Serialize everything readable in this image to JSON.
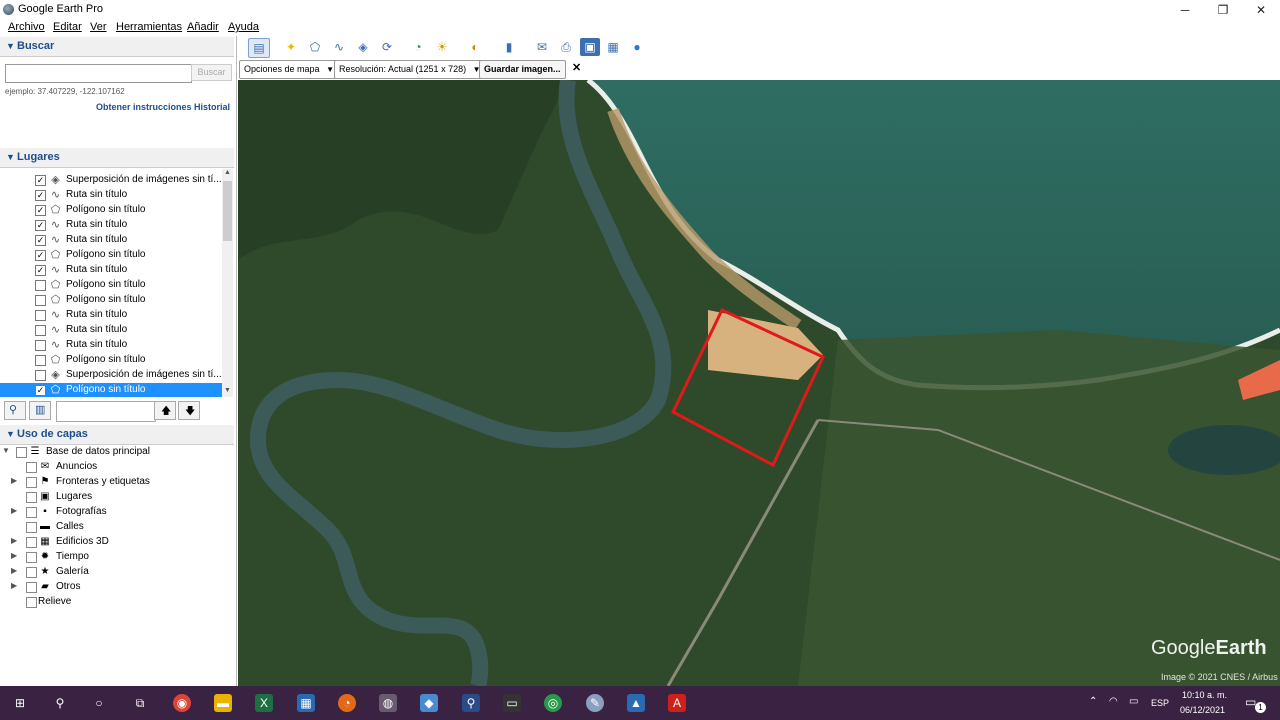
{
  "window": {
    "title": "Google Earth Pro",
    "minimize": "─",
    "maximize": "❐",
    "close": "✕"
  },
  "menu": [
    "Archivo",
    "Editar",
    "Ver",
    "Herramientas",
    "Añadir",
    "Ayuda"
  ],
  "search": {
    "header": "Buscar",
    "input_value": "",
    "button": "Buscar",
    "example": "ejemplo: 37.407229, -122.107162",
    "directions_link": "Obtener instrucciones",
    "history_link": "Historial"
  },
  "places": {
    "header": "Lugares",
    "items": [
      {
        "label": "Superposición de imágenes sin tí...",
        "checked": true,
        "icon": "image-overlay-icon",
        "selected": false
      },
      {
        "label": "Ruta sin título",
        "checked": true,
        "icon": "path-icon",
        "selected": false
      },
      {
        "label": "Polígono sin título",
        "checked": true,
        "icon": "polygon-icon",
        "selected": false
      },
      {
        "label": "Ruta sin título",
        "checked": true,
        "icon": "path-icon",
        "selected": false
      },
      {
        "label": "Ruta sin título",
        "checked": true,
        "icon": "path-icon",
        "selected": false
      },
      {
        "label": "Polígono sin título",
        "checked": true,
        "icon": "polygon-icon",
        "selected": false
      },
      {
        "label": "Ruta sin título",
        "checked": true,
        "icon": "path-icon",
        "selected": false
      },
      {
        "label": "Polígono sin título",
        "checked": false,
        "icon": "polygon-icon",
        "selected": false
      },
      {
        "label": "Polígono sin título",
        "checked": false,
        "icon": "polygon-icon",
        "selected": false
      },
      {
        "label": "Ruta sin título",
        "checked": false,
        "icon": "path-icon",
        "selected": false
      },
      {
        "label": "Ruta sin título",
        "checked": false,
        "icon": "path-icon",
        "selected": false
      },
      {
        "label": "Ruta sin título",
        "checked": false,
        "icon": "path-icon",
        "selected": false
      },
      {
        "label": "Polígono sin título",
        "checked": false,
        "icon": "polygon-icon",
        "selected": false
      },
      {
        "label": "Superposición de imágenes sin tí...",
        "checked": false,
        "icon": "image-overlay-icon",
        "selected": false
      },
      {
        "label": "Polígono sin título",
        "checked": true,
        "icon": "polygon-icon",
        "selected": true
      }
    ]
  },
  "layers": {
    "header": "Uso de capas",
    "items": [
      {
        "label": "Base de datos principal",
        "icon": "database-icon",
        "expandable": true
      },
      {
        "label": "Anuncios",
        "icon": "announcement-icon",
        "expandable": false
      },
      {
        "label": "Fronteras y etiquetas",
        "icon": "borders-icon",
        "expandable": true
      },
      {
        "label": "Lugares",
        "icon": "places-icon",
        "expandable": false
      },
      {
        "label": "Fotografías",
        "icon": "photos-icon",
        "expandable": true
      },
      {
        "label": "Calles",
        "icon": "roads-icon",
        "expandable": false
      },
      {
        "label": "Edificios 3D",
        "icon": "buildings-3d-icon",
        "expandable": true
      },
      {
        "label": "Tiempo",
        "icon": "weather-icon",
        "expandable": true
      },
      {
        "label": "Galería",
        "icon": "gallery-icon",
        "expandable": true
      },
      {
        "label": "Otros",
        "icon": "folder-icon",
        "expandable": true
      },
      {
        "label": "Relieve",
        "icon": "terrain-icon",
        "expandable": false
      }
    ]
  },
  "map_options": {
    "options_label": "Opciones de mapa",
    "resolution_label": "Resolución: Actual (1251 x 728)",
    "save_button": "Guardar imagen...",
    "close": "✕"
  },
  "map": {
    "watermark_prefix": "Google",
    "watermark_suffix": "Earth",
    "attribution": "Image © 2021 CNES / Airbus"
  },
  "taskbar": {
    "language": "ESP",
    "time": "10:10 a. m.",
    "date": "06/12/2021",
    "notification_count": "1"
  },
  "colors": {
    "accent": "#1e4e8c",
    "selection": "#1e90ff",
    "polygon_outline": "#e01a1a",
    "sea": "#2f6b5e",
    "forest": "#2c4a2a",
    "taskbar": "#3a2243"
  }
}
